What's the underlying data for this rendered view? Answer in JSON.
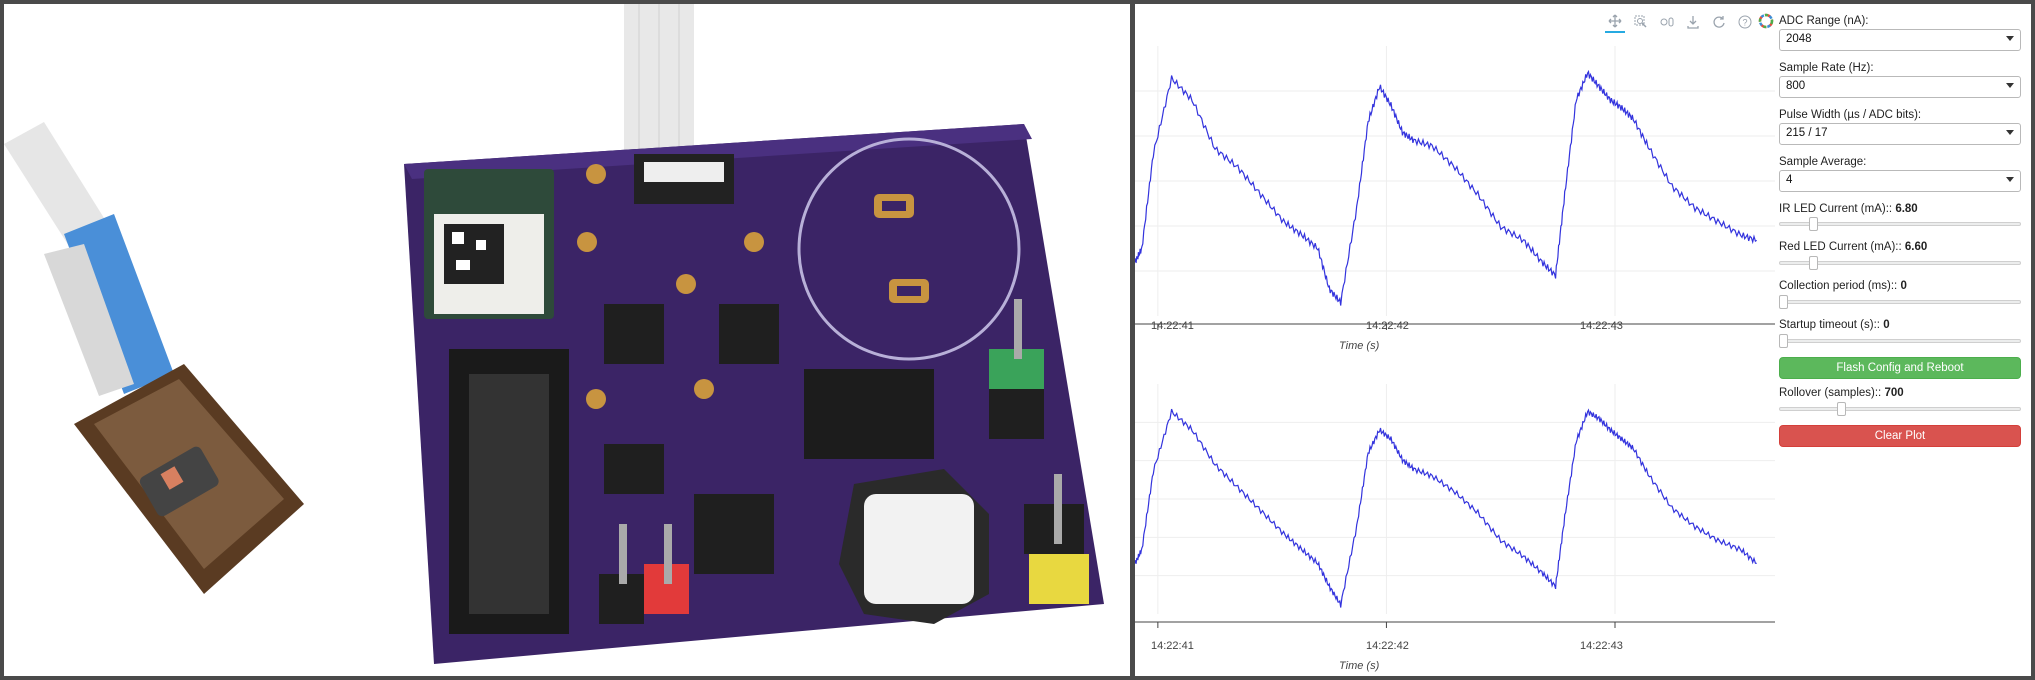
{
  "toolbar": {
    "tools": [
      "pan-icon",
      "box-zoom-icon",
      "wheel-zoom-icon",
      "save-icon",
      "reset-icon",
      "help-icon"
    ],
    "logo": "bokeh-logo-icon"
  },
  "plots": [
    {
      "x_ticks": [
        "14:22:41",
        "14:22:42",
        "14:22:43"
      ],
      "x_title": "Time (s)"
    },
    {
      "x_ticks": [
        "14:22:41",
        "14:22:42",
        "14:22:43"
      ],
      "x_title": "Time (s)"
    }
  ],
  "chart_data": [
    {
      "type": "line",
      "title": "",
      "xlabel": "Time (s)",
      "ylabel": "",
      "x_tick_labels": [
        "14:22:41",
        "14:22:42",
        "14:22:43"
      ],
      "xlim": [
        40.9,
        43.7
      ],
      "ylim": [
        0,
        1
      ],
      "grid": true,
      "series": [
        {
          "x": [
            40.9,
            40.93,
            40.98,
            41.06,
            41.15,
            41.25,
            41.35,
            41.45,
            41.55,
            41.63,
            41.7,
            41.75,
            41.8,
            41.87,
            41.92,
            41.97,
            42.02,
            42.07,
            42.12,
            42.2,
            42.3,
            42.4,
            42.5,
            42.6,
            42.68,
            42.74,
            42.78,
            42.83,
            42.88,
            42.93,
            42.98,
            43.03,
            43.08,
            43.15,
            43.25,
            43.35,
            43.45,
            43.55,
            43.62
          ],
          "y": [
            0.2,
            0.25,
            0.6,
            0.88,
            0.8,
            0.62,
            0.55,
            0.45,
            0.35,
            0.3,
            0.25,
            0.1,
            0.05,
            0.4,
            0.72,
            0.85,
            0.78,
            0.68,
            0.65,
            0.63,
            0.55,
            0.45,
            0.33,
            0.28,
            0.2,
            0.15,
            0.45,
            0.8,
            0.9,
            0.85,
            0.8,
            0.77,
            0.73,
            0.62,
            0.48,
            0.4,
            0.35,
            0.3,
            0.28
          ]
        }
      ]
    },
    {
      "type": "line",
      "title": "",
      "xlabel": "Time (s)",
      "ylabel": "",
      "x_tick_labels": [
        "14:22:41",
        "14:22:42",
        "14:22:43"
      ],
      "xlim": [
        40.9,
        43.7
      ],
      "ylim": [
        0,
        1
      ],
      "grid": true,
      "series": [
        {
          "x": [
            40.9,
            40.93,
            40.98,
            41.06,
            41.15,
            41.25,
            41.35,
            41.45,
            41.55,
            41.63,
            41.7,
            41.75,
            41.8,
            41.87,
            41.92,
            41.97,
            42.02,
            42.07,
            42.12,
            42.2,
            42.3,
            42.4,
            42.5,
            42.6,
            42.68,
            42.74,
            42.78,
            42.83,
            42.88,
            42.93,
            42.98,
            43.03,
            43.08,
            43.15,
            43.25,
            43.35,
            43.45,
            43.55,
            43.62
          ],
          "y": [
            0.22,
            0.28,
            0.62,
            0.88,
            0.8,
            0.65,
            0.55,
            0.45,
            0.35,
            0.28,
            0.22,
            0.12,
            0.04,
            0.38,
            0.7,
            0.8,
            0.76,
            0.67,
            0.63,
            0.6,
            0.53,
            0.44,
            0.32,
            0.25,
            0.18,
            0.12,
            0.42,
            0.75,
            0.88,
            0.85,
            0.8,
            0.76,
            0.72,
            0.6,
            0.46,
            0.38,
            0.32,
            0.28,
            0.22
          ]
        }
      ]
    }
  ],
  "controls": {
    "adc_range": {
      "label": "ADC Range (nA):",
      "value": "2048"
    },
    "sample_rate": {
      "label": "Sample Rate (Hz):",
      "value": "800"
    },
    "pulse_width": {
      "label": "Pulse Width (µs / ADC bits):",
      "value": "215 / 17"
    },
    "sample_average": {
      "label": "Sample Average:",
      "value": "4"
    },
    "ir_led": {
      "label": "IR LED Current (mA):: ",
      "value": "6.80",
      "fraction": 0.13
    },
    "red_led": {
      "label": "Red LED Current (mA):: ",
      "value": "6.60",
      "fraction": 0.13
    },
    "collection_period": {
      "label": "Collection period (ms):: ",
      "value": "0",
      "fraction": 0.0
    },
    "startup_timeout": {
      "label": "Startup timeout (s):: ",
      "value": "0",
      "fraction": 0.0
    },
    "flash_button": "Flash Config and Reboot",
    "rollover": {
      "label": "Rollover (samples):: ",
      "value": "700",
      "fraction": 0.25
    },
    "clear_button": "Clear Plot"
  },
  "colors": {
    "line": "#3333dd",
    "flash": "#5cb85c",
    "clear": "#d9534f",
    "pcb": "#3b2466"
  }
}
